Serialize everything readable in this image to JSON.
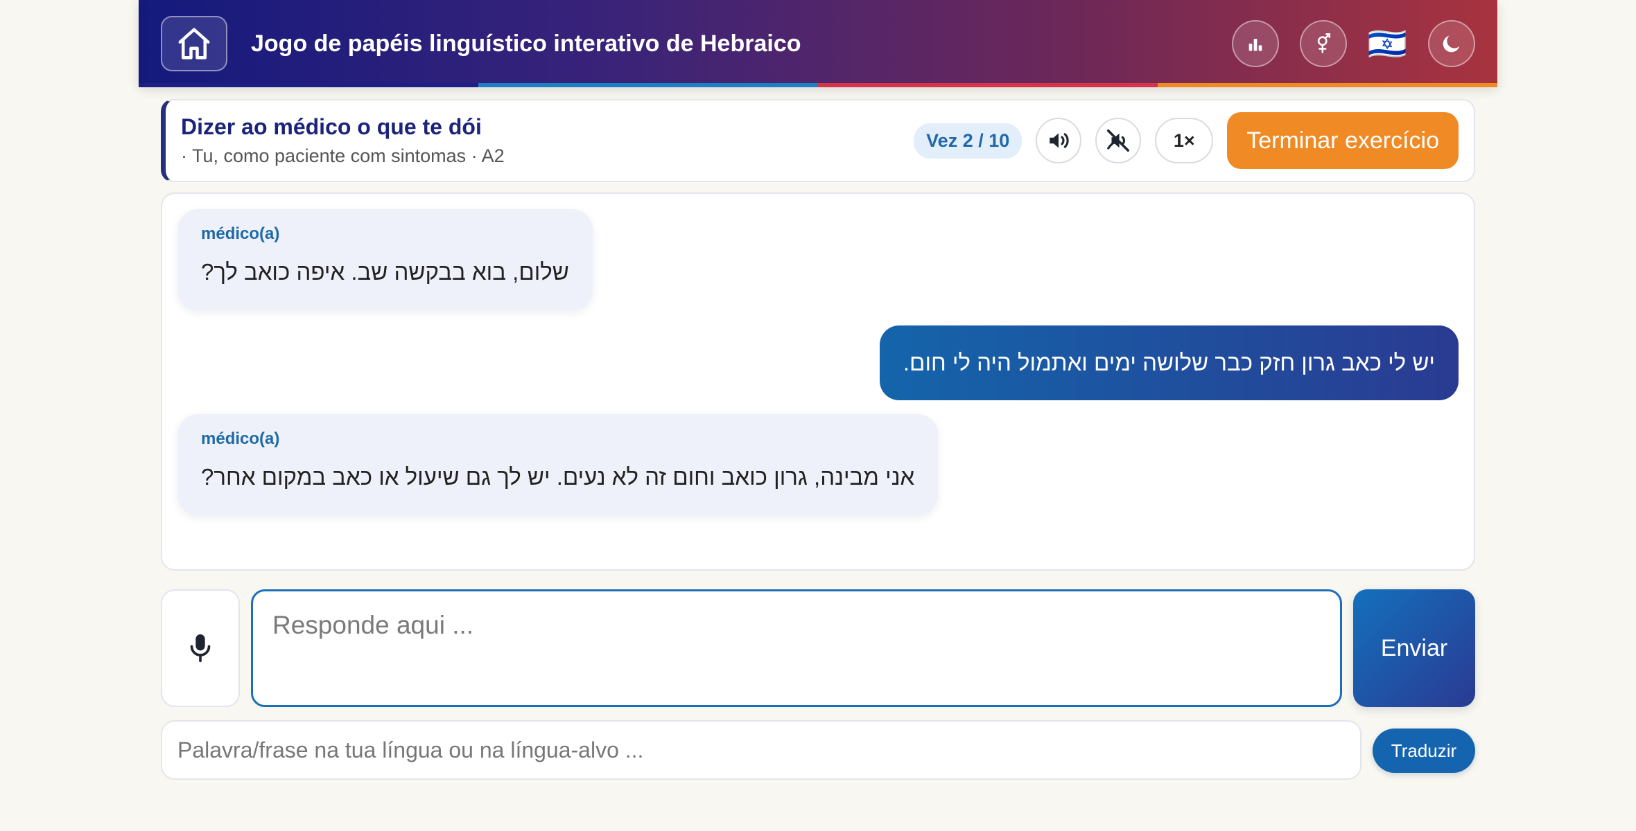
{
  "header": {
    "title": "Jogo de papéis linguístico interativo de Hebraico",
    "flag": "🇮🇱",
    "stripe_colors": [
      "#1d1f86",
      "#1d7fc4",
      "#d6344b",
      "#f08a24"
    ],
    "icons": {
      "home": "home-icon",
      "stats": "bar-chart-icon",
      "gender": "gender-icon",
      "theme": "moon-icon"
    }
  },
  "exercise": {
    "title": "Dizer ao médico o que te dói",
    "subtitle": "· Tu, como paciente com sintomas · A2",
    "turn": "Vez 2 / 10",
    "speed": "1×",
    "finish_label": "Terminar exercício",
    "icons": {
      "audio": "speaker-icon",
      "mute_voice": "mute-speaker-icon"
    }
  },
  "chat": {
    "messages": [
      {
        "role": "médico(a)",
        "text": "שלום, בוא בבקשה שב. איפה כואב לך?"
      },
      {
        "text": "יש לי כאב גרון חזק כבר שלושה ימים ואתמול היה לי חום."
      },
      {
        "role": "médico(a)",
        "text": "אני מבינה, גרון כואב וחום זה לא נעים. יש לך גם שיעול או כאב במקום אחר?"
      }
    ]
  },
  "composer": {
    "placeholder": "Responde aqui ...",
    "value": "",
    "send_label": "Enviar",
    "mic_icon": "microphone-icon"
  },
  "translate": {
    "placeholder": "Palavra/frase na tua língua ou na língua-alvo ...",
    "value": "",
    "button_label": "Traduzir"
  },
  "colors": {
    "accent_orange": "#f08a24",
    "accent_blue": "#1564b0",
    "header_gradient_start": "#141a7d",
    "header_gradient_end": "#a8333f"
  }
}
